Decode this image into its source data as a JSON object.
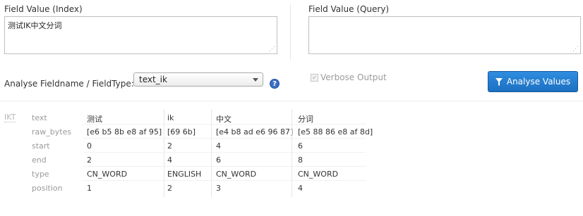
{
  "index_field": {
    "label": "Field Value (Index)",
    "value": "测试IK中文分词"
  },
  "query_field": {
    "label": "Field Value (Query)",
    "value": ""
  },
  "fieldtype": {
    "label": "Analyse Fieldname / FieldType:",
    "selected": "text_ik",
    "help_icon": "question-icon"
  },
  "verbose": {
    "label": "Verbose Output",
    "checked": true
  },
  "analyse_button": {
    "label": "Analyse Values",
    "icon": "filter-funnel-icon"
  },
  "analysis": {
    "stage": "IKT",
    "row_labels": [
      "text",
      "raw_bytes",
      "start",
      "end",
      "type",
      "position"
    ],
    "tokens": [
      {
        "text": "测试",
        "raw_bytes": "[e6 b5 8b e8 af 95]",
        "start": "0",
        "end": "2",
        "type": "CN_WORD",
        "position": "1"
      },
      {
        "text": "ik",
        "raw_bytes": "[69 6b]",
        "start": "2",
        "end": "4",
        "type": "ENGLISH",
        "position": "2"
      },
      {
        "text": "中文",
        "raw_bytes": "[e4 b8 ad e6 96 87]",
        "start": "4",
        "end": "6",
        "type": "CN_WORD",
        "position": "3"
      },
      {
        "text": "分词",
        "raw_bytes": "[e5 88 86 e8 af 8d]",
        "start": "6",
        "end": "8",
        "type": "CN_WORD",
        "position": "4"
      }
    ]
  }
}
